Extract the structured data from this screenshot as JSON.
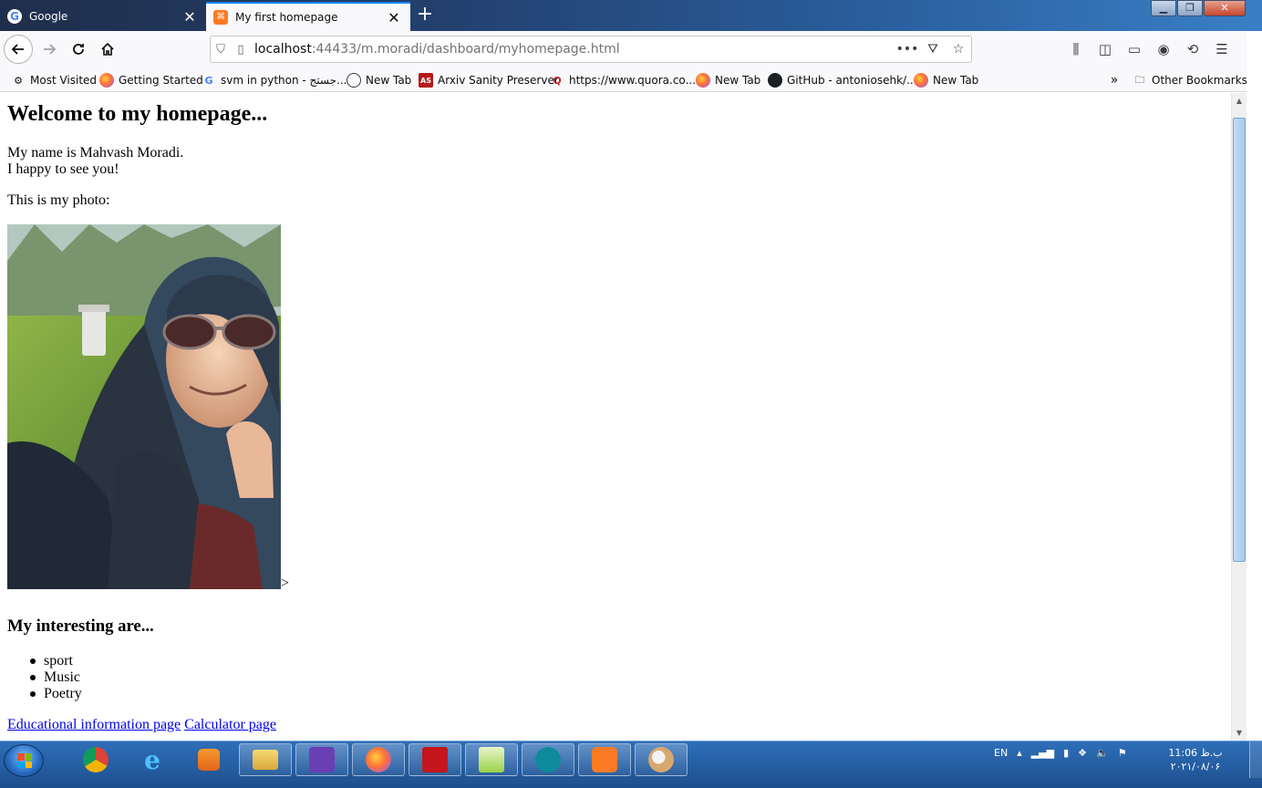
{
  "window": {
    "minimize": "▁",
    "maximize": "❐",
    "close": "✕"
  },
  "tabs": [
    {
      "title": "Google",
      "favicon": "google-g-icon",
      "close": "✕"
    },
    {
      "title": "My first homepage",
      "favicon": "xampp-icon",
      "close": "✕"
    }
  ],
  "newtab_label": "+",
  "nav": {
    "url_host": "localhost",
    "url_rest": ":44433/m.moradi/dashboard/myhomepage.html",
    "icons": [
      "back-arrow-icon",
      "forward-arrow-icon",
      "reload-icon",
      "home-icon",
      "shield-icon",
      "page-icon",
      "more-icon",
      "pocket-icon",
      "star-icon",
      "library-icon",
      "sidebar-icon",
      "reader-icon",
      "account-icon",
      "sync-icon",
      "menu-icon"
    ]
  },
  "bookmarks": [
    {
      "label": "Most Visited",
      "icon": "gear-icon"
    },
    {
      "label": "Getting Started",
      "icon": "firefox-icon"
    },
    {
      "label": "svm in python - جستج...",
      "icon": "google-g-icon"
    },
    {
      "label": "New Tab",
      "icon": "globe-icon"
    },
    {
      "label": "Arxiv Sanity Preserver",
      "icon": "arxiv-icon"
    },
    {
      "label": "https://www.quora.co...",
      "icon": "quora-icon"
    },
    {
      "label": "New Tab",
      "icon": "firefox-icon"
    },
    {
      "label": "GitHub - antoniosehk/...",
      "icon": "github-icon"
    },
    {
      "label": "New Tab",
      "icon": "firefox-icon"
    },
    {
      "label": "Other Bookmarks",
      "icon": "folder-icon"
    }
  ],
  "page": {
    "heading": "Welcome to my homepage...",
    "intro_line1": "My name is Mahvash Moradi.",
    "intro_line2": "I happy to see you!",
    "photo_label": "This is my photo:",
    "stray_char": ">",
    "interests_heading": "My interesting are...",
    "interests": [
      "sport",
      "Music",
      "Poetry"
    ],
    "links": [
      "Educational information page",
      "Calculator page"
    ]
  },
  "scrollbar": {
    "position_fraction": 0.0,
    "visible_fraction": 0.72
  },
  "taskbar": {
    "apps": [
      "chrome-icon",
      "internet-explorer-icon",
      "media-player-icon",
      "file-explorer-icon",
      "visual-studio-icon",
      "firefox-icon",
      "acrobat-icon",
      "notepad-plus-plus-icon",
      "edge-icon",
      "xampp-icon",
      "paint-icon"
    ],
    "language": "EN",
    "time": "11:06 ب.ظ",
    "date": "۲۰۲۱/۰۸/۰۶"
  },
  "colors": {
    "link": "#0000ee",
    "tab_accent": "#0a84ff",
    "taskbar": "#1c4f8e"
  }
}
